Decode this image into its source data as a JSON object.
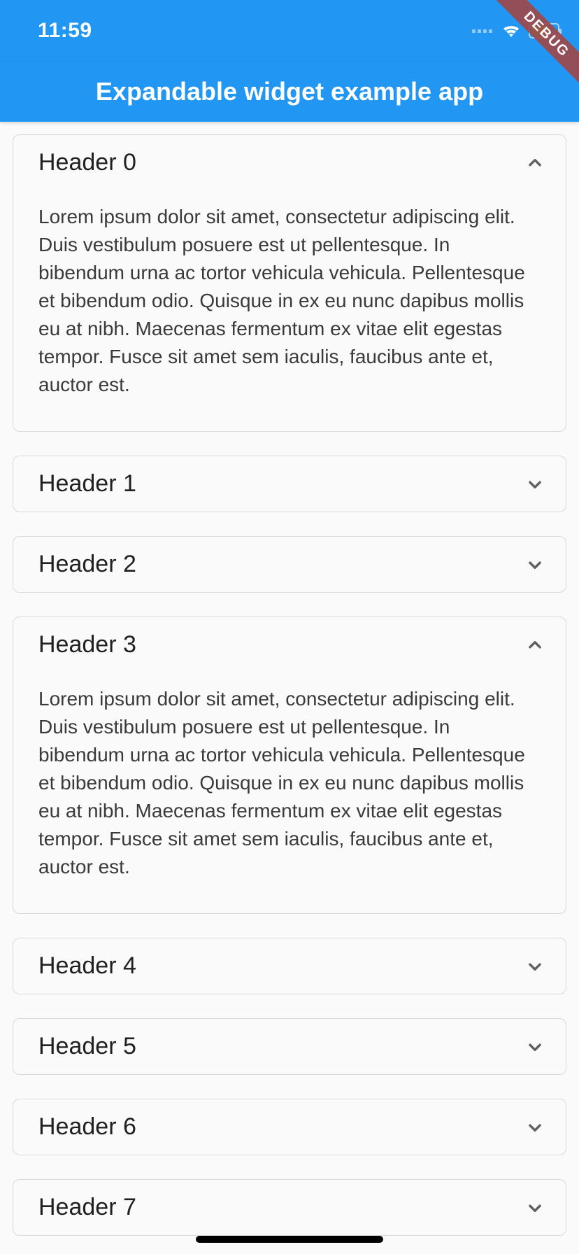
{
  "status": {
    "time": "11:59"
  },
  "debug_banner": "DEBUG",
  "app_bar": {
    "title": "Expandable widget example app"
  },
  "lorem": "Lorem ipsum dolor sit amet, consectetur adipiscing elit. Duis vestibulum posuere est ut pellentesque. In bibendum urna ac tortor vehicula vehicula. Pellentesque et bibendum odio. Quisque in ex eu nunc dapibus mollis eu at nibh. Maecenas fermentum ex vitae elit egestas tempor. Fusce sit amet sem iaculis, faucibus ante et, auctor est.",
  "panels": [
    {
      "title": "Header 0",
      "expanded": true
    },
    {
      "title": "Header 1",
      "expanded": false
    },
    {
      "title": "Header 2",
      "expanded": false
    },
    {
      "title": "Header 3",
      "expanded": true
    },
    {
      "title": "Header 4",
      "expanded": false
    },
    {
      "title": "Header 5",
      "expanded": false
    },
    {
      "title": "Header 6",
      "expanded": false
    },
    {
      "title": "Header 7",
      "expanded": false
    }
  ]
}
